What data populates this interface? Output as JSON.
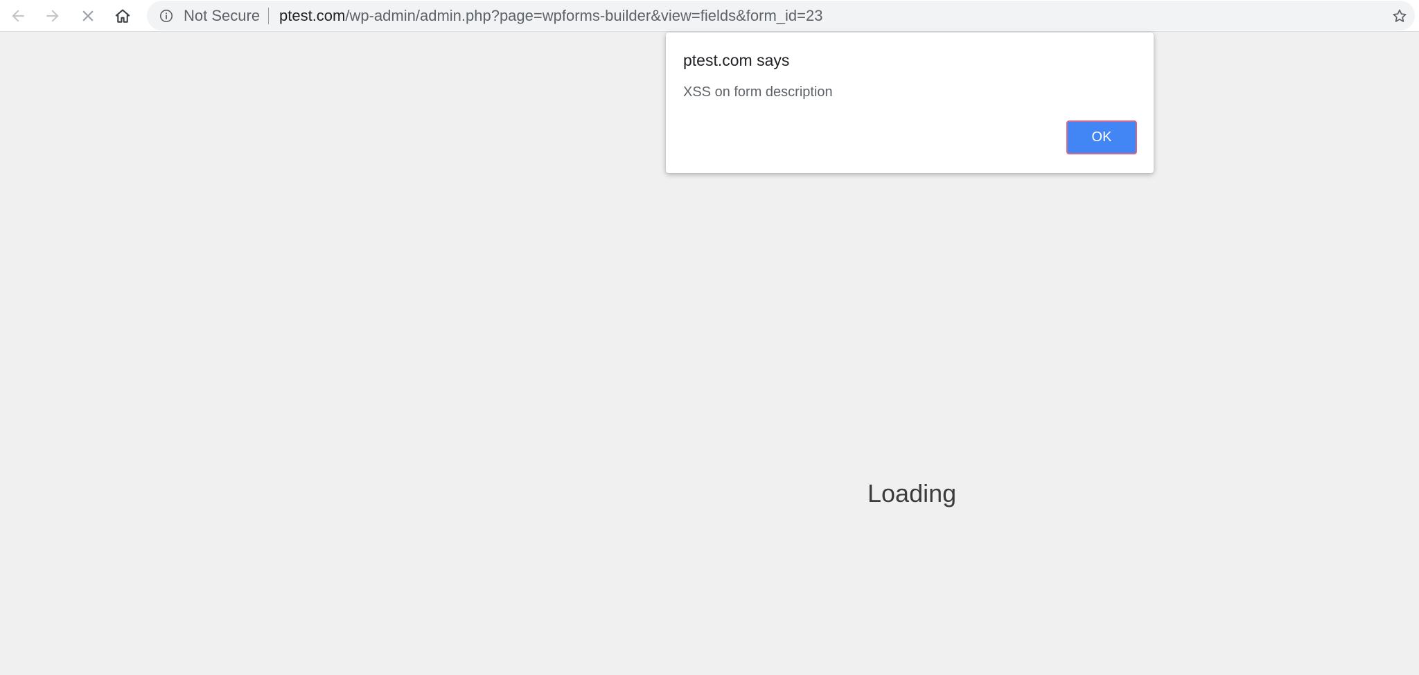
{
  "browser": {
    "nav": {
      "back_icon": "arrow-left-icon",
      "forward_icon": "arrow-right-icon",
      "stop_icon": "close-x-icon",
      "home_icon": "home-icon"
    },
    "omnibox": {
      "info_icon": "info-circle-icon",
      "security_label": "Not Secure",
      "url_host": "ptest.com",
      "url_path": "/wp-admin/admin.php?page=wpforms-builder&view=fields&form_id=23",
      "bookmark_icon": "star-outline-icon"
    }
  },
  "page": {
    "status_text": "Loading",
    "background_color": "#f0f0f0"
  },
  "alert_dialog": {
    "title": "ptest.com says",
    "message": "XSS on form description",
    "ok_label": "OK",
    "accent_color": "#4285f4"
  }
}
